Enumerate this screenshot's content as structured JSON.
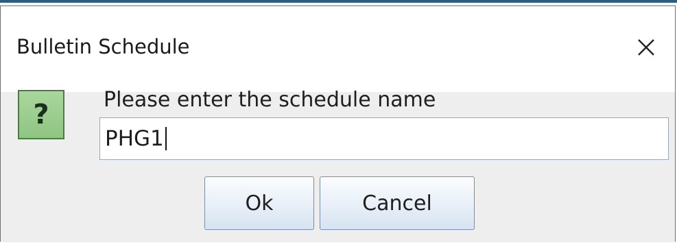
{
  "dialog": {
    "title": "Bulletin Schedule",
    "close_icon": "close-icon",
    "message_icon": "question-icon",
    "message_icon_glyph": "?",
    "prompt": "Please enter the schedule name",
    "input": {
      "value": "PHG1"
    },
    "buttons": {
      "ok_label": "Ok",
      "cancel_label": "Cancel"
    }
  },
  "colors": {
    "top_strip": "#2c5d85",
    "icon_green": "#8fc582",
    "button_border": "#7a8ea6"
  }
}
